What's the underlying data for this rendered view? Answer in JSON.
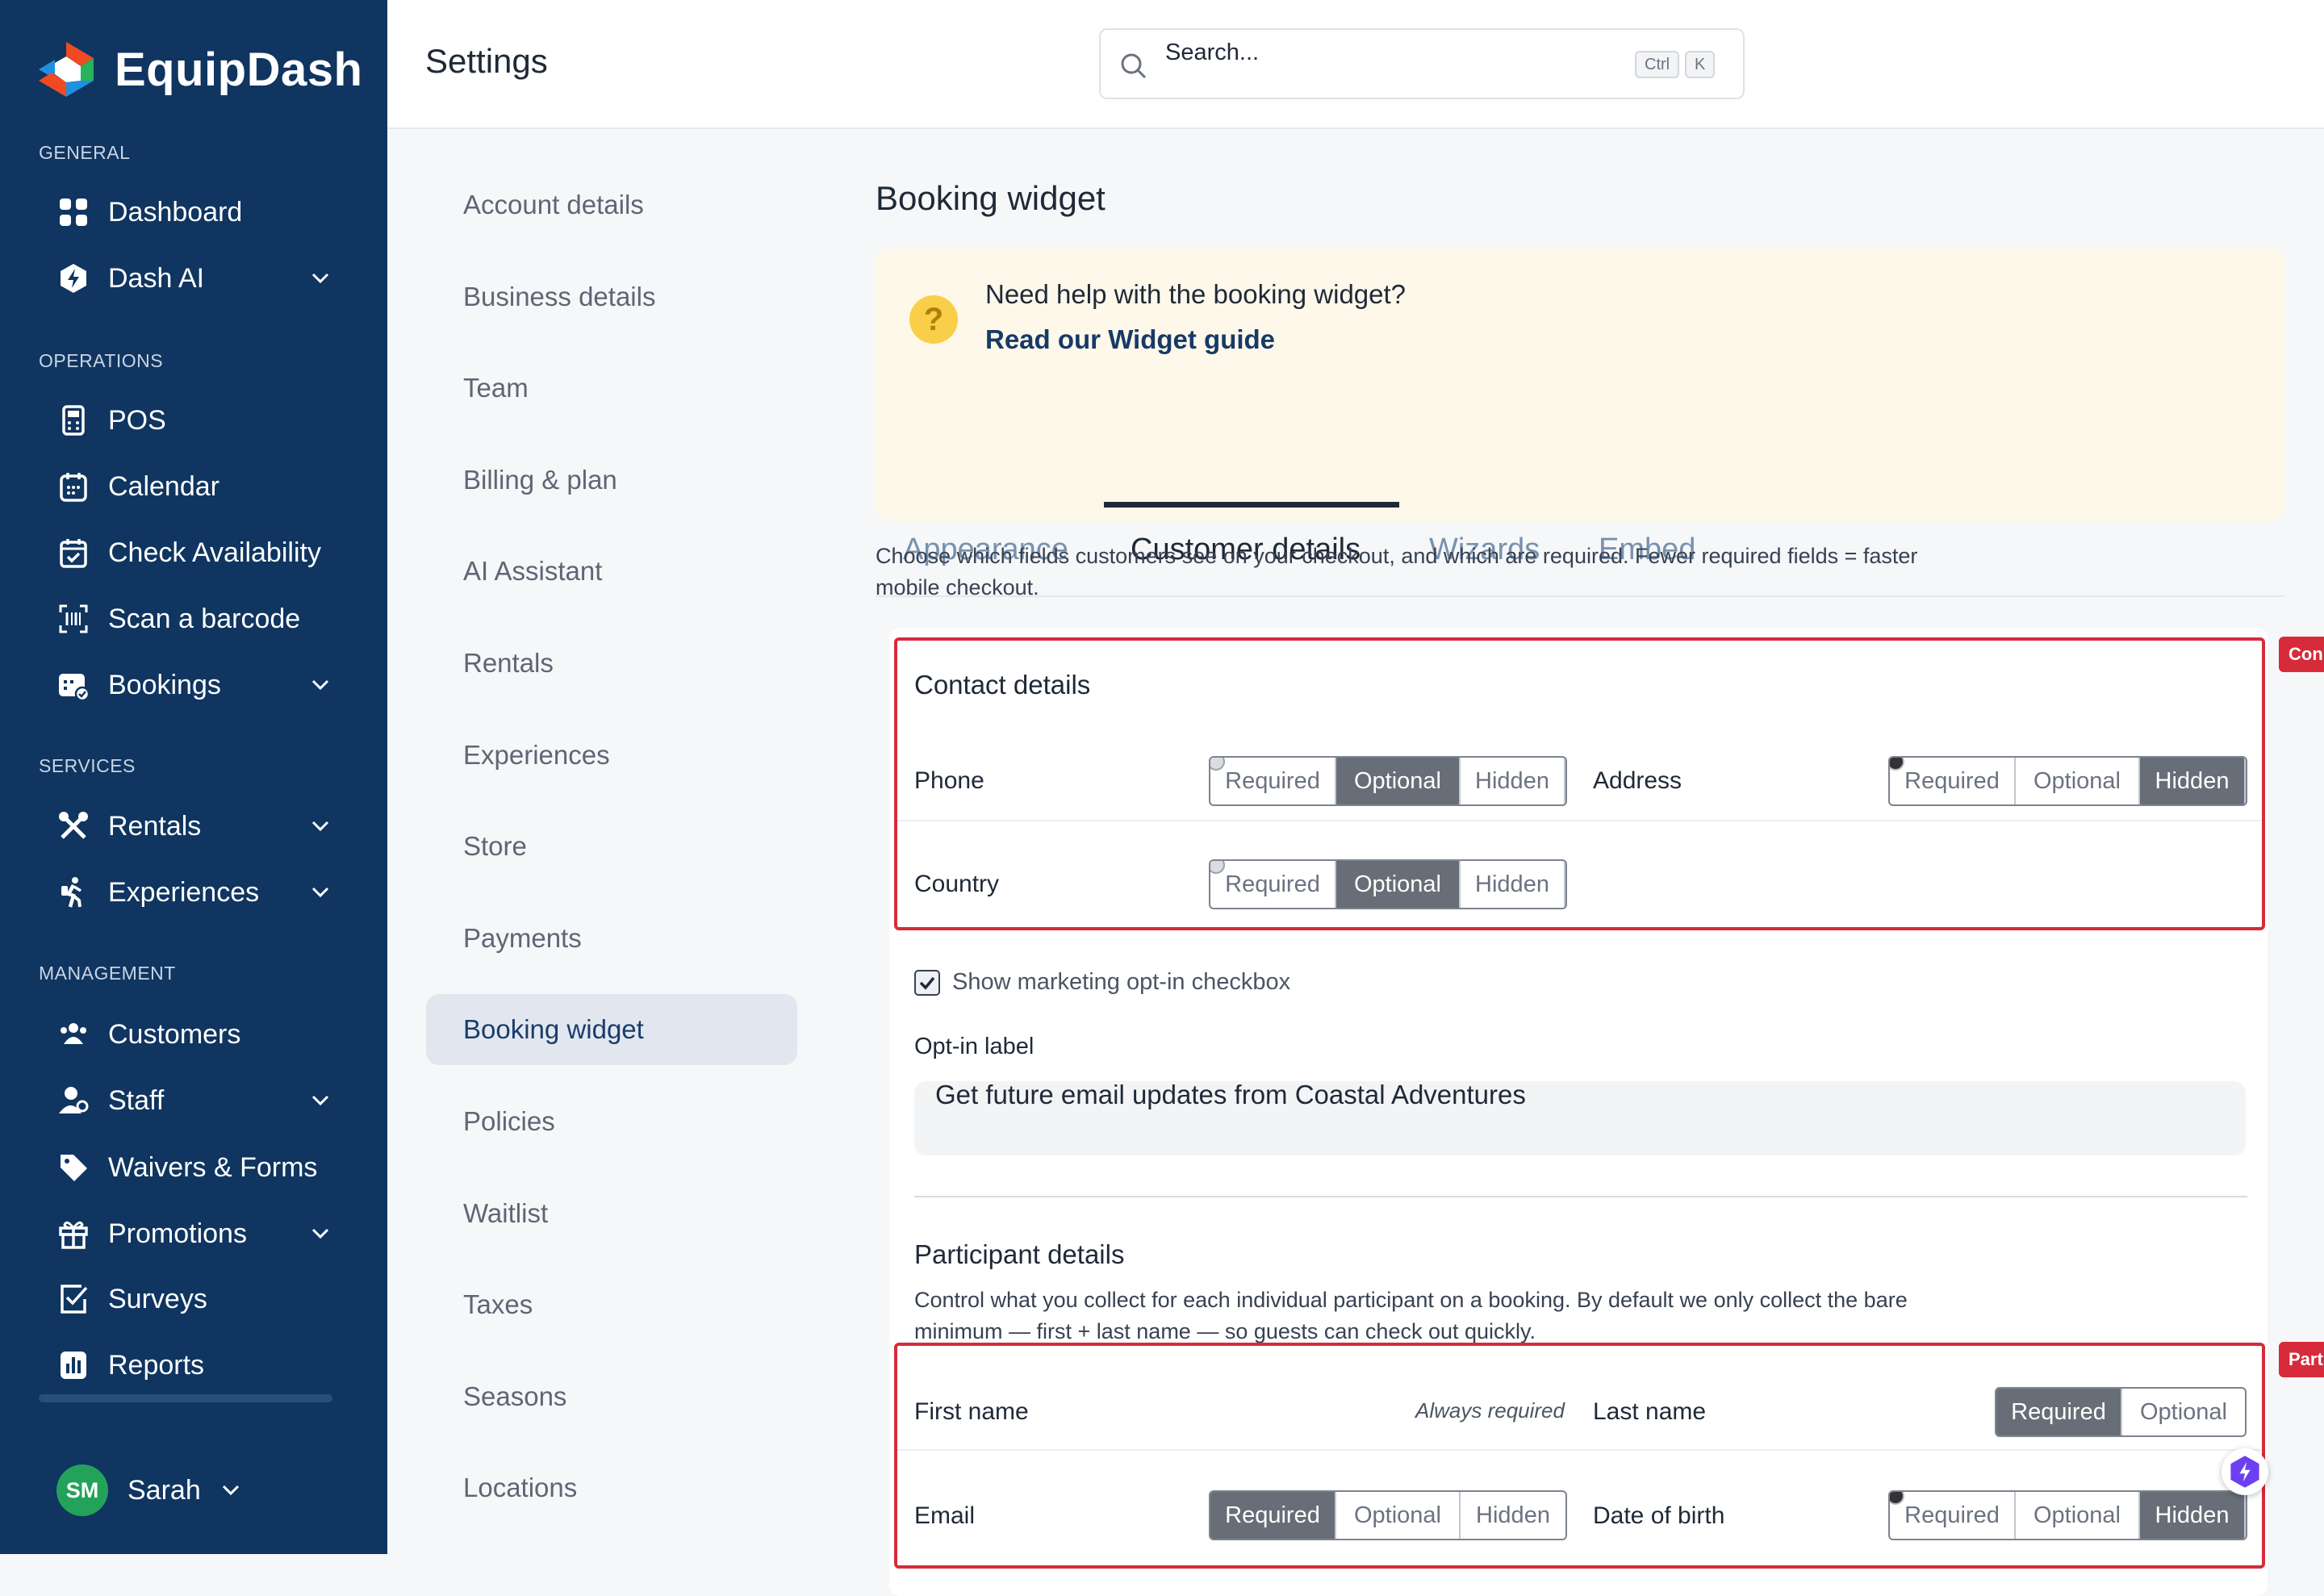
{
  "app": {
    "name": "EquipDash"
  },
  "sidebar": {
    "sections": [
      {
        "label": "GENERAL",
        "items": [
          {
            "label": "Dashboard",
            "icon": "grid-icon"
          },
          {
            "label": "Dash AI",
            "icon": "hexagon-bolt-icon",
            "expandable": true
          }
        ]
      },
      {
        "label": "OPERATIONS",
        "items": [
          {
            "label": "POS",
            "icon": "pos-terminal-icon"
          },
          {
            "label": "Calendar",
            "icon": "calendar-icon"
          },
          {
            "label": "Check Availability",
            "icon": "calendar-check-icon"
          },
          {
            "label": "Scan a barcode",
            "icon": "barcode-scan-icon"
          },
          {
            "label": "Bookings",
            "icon": "bookings-icon",
            "expandable": true
          }
        ]
      },
      {
        "label": "SERVICES",
        "items": [
          {
            "label": "Rentals",
            "icon": "tools-icon",
            "expandable": true
          },
          {
            "label": "Experiences",
            "icon": "hiker-icon",
            "expandable": true
          }
        ]
      },
      {
        "label": "MANAGEMENT",
        "items": [
          {
            "label": "Customers",
            "icon": "users-icon"
          },
          {
            "label": "Staff",
            "icon": "staff-icon",
            "expandable": true
          },
          {
            "label": "Waivers & Forms",
            "icon": "tag-icon"
          },
          {
            "label": "Promotions",
            "icon": "gift-icon",
            "expandable": true
          },
          {
            "label": "Surveys",
            "icon": "checklist-icon"
          },
          {
            "label": "Reports",
            "icon": "bar-chart-icon"
          }
        ]
      }
    ],
    "profile": {
      "initials": "SM",
      "name": "Sarah"
    }
  },
  "topbar": {
    "title": "Settings",
    "search": {
      "placeholder": "Search...",
      "shortcut_keys": [
        "Ctrl",
        "K"
      ]
    }
  },
  "settings_menu": {
    "items": [
      "Account details",
      "Business details",
      "Team",
      "Billing & plan",
      "AI Assistant",
      "Rentals",
      "Experiences",
      "Store",
      "Payments",
      "Booking widget",
      "Policies",
      "Waitlist",
      "Taxes",
      "Seasons",
      "Locations"
    ],
    "active": "Booking widget"
  },
  "main": {
    "title": "Booking widget",
    "help": {
      "question": "Need help with the booking widget?",
      "link": "Read our Widget guide"
    },
    "tabs": [
      "Appearance",
      "Customer details",
      "Wizards",
      "Embed"
    ],
    "active_tab": "Customer details",
    "description": "Choose which fields customers see on your checkout, and which are required. Fewer required fields = faster mobile checkout.",
    "segment_options": [
      "Required",
      "Optional",
      "Hidden"
    ],
    "contact": {
      "title": "Contact details",
      "flag": "Con",
      "fields": [
        {
          "label": "Phone",
          "selected": "Optional"
        },
        {
          "label": "Address",
          "selected": "Hidden"
        },
        {
          "label": "Country",
          "selected": "Optional"
        }
      ]
    },
    "marketing": {
      "checkbox_label": "Show marketing opt-in checkbox",
      "checked": true,
      "optin_label": "Opt-in label",
      "optin_value": "Get future email updates from Coastal Adventures"
    },
    "participant": {
      "title": "Participant details",
      "flag": "Part",
      "description": "Control what you collect for each individual participant on a booking. By default we only collect the bare minimum — first + last name — so guests can check out quickly.",
      "first_name": {
        "label": "First name",
        "note": "Always required"
      },
      "last_name": {
        "label": "Last name",
        "options": [
          "Required",
          "Optional"
        ],
        "selected": "Required"
      },
      "email": {
        "label": "Email",
        "selected": "Required"
      },
      "dob": {
        "label": "Date of birth",
        "selected": "Hidden"
      }
    }
  },
  "colors": {
    "sidebar_bg": "#0f3560",
    "accent_red": "#d62b3b",
    "segment_selected": "#686e77",
    "help_bg": "#fef8eb"
  }
}
